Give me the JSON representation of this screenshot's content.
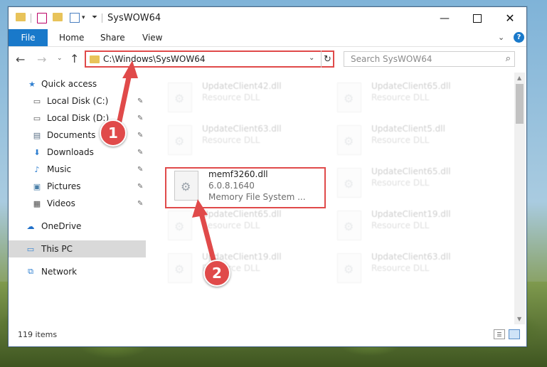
{
  "window": {
    "title": "SysWOW64",
    "minimize_glyph": "—",
    "close_glyph": "✕"
  },
  "ribbon": {
    "tabs": [
      "File",
      "Home",
      "Share",
      "View"
    ]
  },
  "nav": {
    "back_glyph": "←",
    "forward_glyph": "→",
    "recent_glyph": "⌄",
    "up_glyph": "↑",
    "address": "C:\\Windows\\SysWOW64",
    "address_dropdown": "⌄",
    "refresh_glyph": "↻",
    "search_placeholder": "Search SysWOW64",
    "search_glyph": "⌕"
  },
  "sidebar": {
    "items": [
      {
        "label": "Quick access",
        "icon": "star-icon",
        "glyph": "★",
        "color": "#2f7fd0",
        "pinned": false
      },
      {
        "label": "Local Disk (C:)",
        "icon": "drive-icon",
        "glyph": "▭",
        "color": "#555555",
        "pinned": true
      },
      {
        "label": "Local Disk (D:)",
        "icon": "drive-icon",
        "glyph": "▭",
        "color": "#555555",
        "pinned": true
      },
      {
        "label": "Documents",
        "icon": "documents-icon",
        "glyph": "▤",
        "color": "#5a6f86",
        "pinned": true
      },
      {
        "label": "Downloads",
        "icon": "download-icon",
        "glyph": "⬇",
        "color": "#2f7fd0",
        "pinned": true
      },
      {
        "label": "Music",
        "icon": "music-icon",
        "glyph": "♪",
        "color": "#2f7fd0",
        "pinned": true
      },
      {
        "label": "Pictures",
        "icon": "pictures-icon",
        "glyph": "▣",
        "color": "#4a7fa8",
        "pinned": true
      },
      {
        "label": "Videos",
        "icon": "videos-icon",
        "glyph": "▦",
        "color": "#4a4a4a",
        "pinned": true
      },
      {
        "label": "OneDrive",
        "icon": "cloud-icon",
        "glyph": "☁",
        "color": "#1f6fc8",
        "pinned": false
      },
      {
        "label": "This PC",
        "icon": "computer-icon",
        "glyph": "▭",
        "color": "#2f7fd0",
        "pinned": false
      },
      {
        "label": "Network",
        "icon": "network-icon",
        "glyph": "⧉",
        "color": "#2f7fd0",
        "pinned": false
      }
    ],
    "pin_glyph": "📌"
  },
  "files": [
    {
      "name": "UpdateClient42.dll",
      "desc": "Resource DLL",
      "extra": "",
      "faded": true
    },
    {
      "name": "UpdateClient65.dll",
      "desc": "Resource DLL",
      "extra": "",
      "faded": true
    },
    {
      "name": "UpdateClient63.dll",
      "desc": "Resource DLL",
      "extra": "",
      "faded": true
    },
    {
      "name": "UpdateClient5.dll",
      "desc": "Resource DLL",
      "extra": "",
      "faded": true
    },
    {
      "name": "memf3260.dll",
      "desc": "6.0.8.1640",
      "extra": "Memory File System ...",
      "faded": false
    },
    {
      "name": "UpdateClient65.dll",
      "desc": "Resource DLL",
      "extra": "",
      "faded": true
    },
    {
      "name": "UpdateClient65.dll",
      "desc": "Resource DLL",
      "extra": "",
      "faded": true
    },
    {
      "name": "UpdateClient19.dll",
      "desc": "Resource DLL",
      "extra": "",
      "faded": true
    },
    {
      "name": "UpdateClient19.dll",
      "desc": "Resource DLL",
      "extra": "",
      "faded": true
    },
    {
      "name": "UpdateClient63.dll",
      "desc": "Resource DLL",
      "extra": "",
      "faded": true
    }
  ],
  "status": {
    "count": "119 items"
  },
  "annotations": {
    "step1": "1",
    "step2": "2",
    "highlight_color": "#e04a4a"
  }
}
